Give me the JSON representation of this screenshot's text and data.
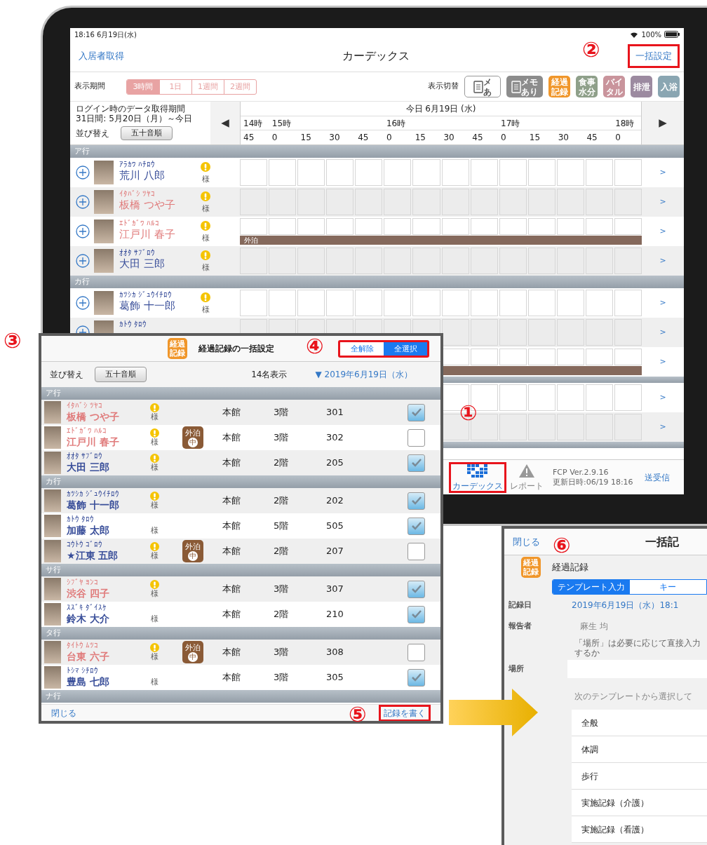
{
  "main": {
    "status_bar": {
      "time": "18:16  6月19日(水)",
      "battery": "100%"
    },
    "nav": {
      "left": "入居者取得",
      "title": "カーデックス",
      "right": "一括設定",
      "right_highlighted": true,
      "right_callout": "②"
    },
    "period": {
      "label": "表示期間",
      "options": [
        {
          "label": "3時間",
          "selected": true
        },
        {
          "label": "1日",
          "selected": false
        },
        {
          "label": "1週間",
          "selected": false
        },
        {
          "label": "2週間",
          "selected": false
        }
      ]
    },
    "view": {
      "label": "表示切替",
      "toggles": [
        {
          "kind": "outline",
          "lines": [
            "メ",
            "あ"
          ]
        },
        {
          "kind": "memo",
          "lines": [
            "メモ",
            "あり"
          ],
          "color": "#8c8c8c"
        },
        {
          "kind": "tile",
          "lines": [
            "経過",
            "記録"
          ],
          "color": "#f0962a"
        },
        {
          "kind": "tile",
          "lines": [
            "食事",
            "水分"
          ],
          "color": "#8fa08a"
        },
        {
          "kind": "tile",
          "lines": [
            "バイ",
            "タル"
          ],
          "color": "#c9949c"
        },
        {
          "kind": "tile",
          "lines": [
            "排泄"
          ],
          "color": "#9c8aa0"
        },
        {
          "kind": "tile",
          "lines": [
            "入浴"
          ],
          "color": "#8aa6b2"
        }
      ]
    },
    "timeline": {
      "login_caption": "ログイン時のデータ取得期間",
      "login_range": "31日間:  5月20日（月）～今日",
      "sort_label": "並び替え",
      "sort_button": "五十音順",
      "prev": "◀",
      "next": "▶",
      "date": "今日 6月19日 (水)",
      "hours": [
        "14時",
        "15時",
        "16時",
        "17時",
        "18時"
      ],
      "minutes": [
        "45",
        "0",
        "15",
        "30",
        "45",
        "0",
        "15",
        "30",
        "45",
        "0",
        "15",
        "30",
        "45",
        "0"
      ]
    },
    "rows": [
      {
        "kind": "section",
        "label": "ア行"
      },
      {
        "kind": "resident",
        "furigana": "ｱﾗｶﾜ ﾊﾁﾛｳ",
        "name": "荒川 八郎",
        "color": "#3a4f9a",
        "alert": true,
        "honorific": "様",
        "outing": false,
        "chevron": ">"
      },
      {
        "kind": "resident",
        "furigana": "ｲﾀﾊﾞｼ ﾂﾔｺ",
        "name": "板橋 つや子",
        "color": "#e07b7b",
        "alert": true,
        "honorific": "様",
        "outing": false,
        "chevron": ">"
      },
      {
        "kind": "resident",
        "furigana": "ｴﾄﾞｶﾞﾜ ﾊﾙｺ",
        "name": "江戸川 春子",
        "color": "#e07b7b",
        "alert": true,
        "honorific": "様",
        "outing": true,
        "outing_label": "外泊",
        "chevron": ">"
      },
      {
        "kind": "resident",
        "furigana": "ｵｵﾀ ｻﾌﾞﾛｳ",
        "name": "大田 三郎",
        "color": "#3a4f9a",
        "alert": true,
        "honorific": "様",
        "outing": false,
        "chevron": ">"
      },
      {
        "kind": "section",
        "label": "カ行"
      },
      {
        "kind": "resident",
        "furigana": "ｶﾂｼｶ ｼﾞｭｳｲﾁﾛｳ",
        "name": "葛飾 十一郎",
        "color": "#3a4f9a",
        "alert": true,
        "honorific": "様",
        "outing": false,
        "chevron": ">"
      },
      {
        "kind": "resident",
        "furigana": "ｶﾄｳ ﾀﾛｳ",
        "color": "#3a4f9a",
        "outing": false,
        "chevron": ">"
      },
      {
        "kind": "blank",
        "outing": true,
        "chevron": ">"
      },
      {
        "kind": "band"
      },
      {
        "kind": "blank",
        "outing": false,
        "chevron": ">"
      },
      {
        "kind": "blank",
        "outing": false,
        "chevron": ">"
      },
      {
        "kind": "band"
      }
    ],
    "bottom_tabs": [
      {
        "label": "カーデックス",
        "selected": true,
        "highlighted": true,
        "callout": "①"
      },
      {
        "label": "レポート",
        "selected": false,
        "highlighted": false
      }
    ],
    "version": "FCP Ver.2.9.16",
    "updated": "更新日時:06/19 18:16",
    "sync": "送受信"
  },
  "dialog": {
    "callout": "③",
    "icon_lines": [
      "経過",
      "記録"
    ],
    "title": "経過記録の一括設定",
    "segments": [
      {
        "label": "全解除",
        "selected": false
      },
      {
        "label": "全選択",
        "selected": true
      }
    ],
    "segments_highlighted": true,
    "segments_callout": "④",
    "sort_label": "並び替え",
    "sort_button": "五十音順",
    "count": "14名表示",
    "date": "▼ 2019年6月19日（水）",
    "rows": [
      {
        "kind": "section",
        "label": "ア行"
      },
      {
        "kind": "resident",
        "furigana": "ｲﾀﾊﾞｼ ﾂﾔｺ",
        "name": "板橋 つや子",
        "color": "#e07b7b",
        "alert": true,
        "honorific": "様",
        "building": "本館",
        "floor": "3階",
        "room": "301",
        "checked": true
      },
      {
        "kind": "resident",
        "furigana": "ｴﾄﾞｶﾞﾜ ﾊﾙｺ",
        "name": "江戸川 春子",
        "color": "#e07b7b",
        "alert": true,
        "honorific": "様",
        "badge": [
          "外泊",
          "中"
        ],
        "building": "本館",
        "floor": "3階",
        "room": "302",
        "checked": false
      },
      {
        "kind": "resident",
        "furigana": "ｵｵﾀ ｻﾌﾞﾛｳ",
        "name": "大田 三郎",
        "color": "#3a4f9a",
        "alert": true,
        "honorific": "様",
        "building": "本館",
        "floor": "2階",
        "room": "205",
        "checked": true
      },
      {
        "kind": "section",
        "label": "カ行"
      },
      {
        "kind": "resident",
        "furigana": "ｶﾂｼｶ ｼﾞｭｳｲﾁﾛｳ",
        "name": "葛飾 十一郎",
        "color": "#3a4f9a",
        "alert": true,
        "honorific": "様",
        "building": "本館",
        "floor": "2階",
        "room": "202",
        "checked": true
      },
      {
        "kind": "resident",
        "furigana": "ｶﾄｳ ﾀﾛｳ",
        "name": "加藤 太郎",
        "color": "#3a4f9a",
        "alert": false,
        "honorific": "様",
        "building": "本館",
        "floor": "5階",
        "room": "505",
        "checked": true
      },
      {
        "kind": "resident",
        "furigana": "ｺｳﾄｳ ｺﾞﾛｳ",
        "name": "★江東 五郎",
        "color": "#3a4f9a",
        "alert": true,
        "honorific": "様",
        "badge": [
          "外泊",
          "中"
        ],
        "building": "本館",
        "floor": "2階",
        "room": "207",
        "checked": false
      },
      {
        "kind": "section",
        "label": "サ行"
      },
      {
        "kind": "resident",
        "furigana": "ｼﾌﾞﾔ ﾖﾝｺ",
        "name": "渋谷 四子",
        "color": "#e07b7b",
        "alert": true,
        "honorific": "様",
        "building": "本館",
        "floor": "3階",
        "room": "307",
        "checked": true
      },
      {
        "kind": "resident",
        "furigana": "ｽｽﾞｷ ﾀﾞｲｽｹ",
        "name": "鈴木 大介",
        "color": "#3a4f9a",
        "alert": false,
        "honorific": "様",
        "building": "本館",
        "floor": "2階",
        "room": "210",
        "checked": true
      },
      {
        "kind": "section",
        "label": "タ行"
      },
      {
        "kind": "resident",
        "furigana": "ﾀｲﾄｳ ﾑﾂｺ",
        "name": "台東 六子",
        "color": "#e07b7b",
        "alert": true,
        "honorific": "様",
        "badge": [
          "外泊",
          "中"
        ],
        "building": "本館",
        "floor": "3階",
        "room": "308",
        "checked": false
      },
      {
        "kind": "resident",
        "furigana": "ﾄｼﾏ ｼﾁﾛｳ",
        "name": "豊島 七郎",
        "color": "#3a4f9a",
        "alert": false,
        "honorific": "様",
        "building": "本館",
        "floor": "3階",
        "room": "305",
        "checked": true
      },
      {
        "kind": "section",
        "label": "ナ行"
      }
    ],
    "close": "閉じる",
    "write": "記録を書く",
    "write_highlighted": true,
    "write_callout": "⑤"
  },
  "panel": {
    "callout": "⑥",
    "close": "閉じる",
    "title": "一括記",
    "icon_lines": [
      "経過",
      "記録"
    ],
    "category": "経過記録",
    "tabs": [
      {
        "label": "テンプレート入力",
        "selected": true
      },
      {
        "label": "キー",
        "selected": false
      }
    ],
    "fields": [
      {
        "label": "記録日",
        "value": "2019年6月19日（水）18:1",
        "kind": "link"
      },
      {
        "label": "報告者",
        "value": "麻生 均",
        "kind": "text"
      }
    ],
    "note": "「場所」は必要に応じて直接入力するか",
    "place_label": "場所",
    "prompt": "次のテンプレートから選択して",
    "templates": [
      "全般",
      "体調",
      "歩行",
      "実施記録（介護）",
      "実施記録（看護）"
    ]
  }
}
